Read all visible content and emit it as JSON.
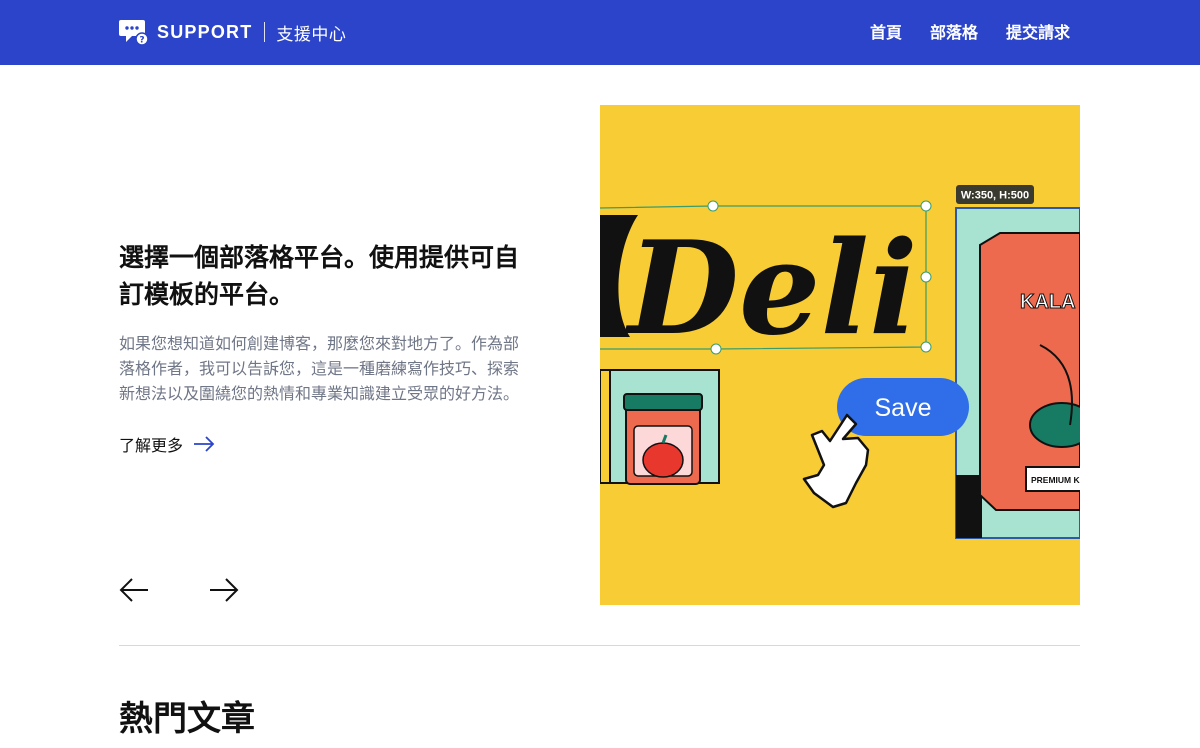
{
  "header": {
    "brand_name": "SUPPORT",
    "brand_sub": "支援中心",
    "nav": [
      {
        "label": "首頁"
      },
      {
        "label": "部落格"
      },
      {
        "label": "提交請求"
      }
    ]
  },
  "hero": {
    "title": "選擇一個部落格平台。使用提供可自訂模板的平台。",
    "description": "如果您想知道如何創建博客，那麼您來對地方了。作為部落格作者，我可以告訴您，這是一種磨練寫作技巧、探索新想法以及圍繞您的熱情和專業知識建立受眾的好方法。",
    "read_more": "了解更多",
    "image": {
      "headline": "Deli",
      "dimension_tag": "W:350, H:500",
      "save_button": "Save",
      "can_brand": "KALA",
      "can_label": "PREMIUM KA"
    }
  },
  "popular": {
    "title": "熱門文章"
  },
  "colors": {
    "header_bg": "#2b44c9",
    "image_bg": "#f8cc35",
    "save_button": "#2f6ee8",
    "selection": "#3a9c6a"
  },
  "icons": {
    "logo": "chat-bubble-question-icon",
    "read_more": "arrow-right-icon",
    "prev": "arrow-left-icon",
    "next": "arrow-right-icon",
    "cursor": "pointing-hand-cursor-icon"
  }
}
